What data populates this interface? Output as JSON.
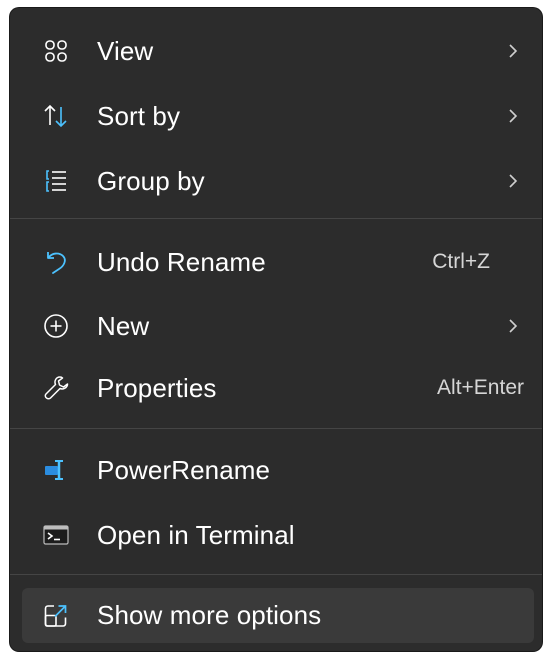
{
  "menu": {
    "items": [
      {
        "id": "view",
        "label": "View",
        "icon": "view-icon",
        "submenu": true
      },
      {
        "id": "sort",
        "label": "Sort by",
        "icon": "sort-icon",
        "submenu": true
      },
      {
        "id": "group",
        "label": "Group by",
        "icon": "group-icon",
        "submenu": true
      },
      {
        "id": "undo",
        "label": "Undo Rename",
        "icon": "undo-icon",
        "shortcut": "Ctrl+Z"
      },
      {
        "id": "new",
        "label": "New",
        "icon": "new-icon",
        "submenu": true
      },
      {
        "id": "properties",
        "label": "Properties",
        "icon": "wrench-icon",
        "shortcut": "Alt+Enter"
      },
      {
        "id": "powerrename",
        "label": "PowerRename",
        "icon": "powerrename-icon"
      },
      {
        "id": "terminal",
        "label": "Open in Terminal",
        "icon": "terminal-icon"
      },
      {
        "id": "more",
        "label": "Show more options",
        "icon": "show-more-icon"
      }
    ]
  },
  "colors": {
    "background": "#2c2c2c",
    "hover": "#3a3a3a",
    "text": "#ffffff",
    "accent": "#4cc2ff",
    "separator": "#454545"
  }
}
